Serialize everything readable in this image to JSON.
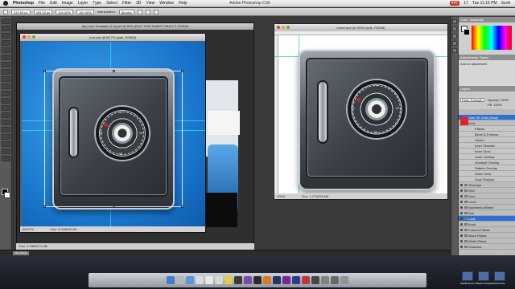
{
  "menubar": {
    "app_name": "Photoshop",
    "menus": [
      "File",
      "Edit",
      "Image",
      "Layer",
      "Type",
      "Select",
      "Filter",
      "3D",
      "View",
      "Window",
      "Help"
    ],
    "window_title": "Adobe Photoshop CS6",
    "status_items": [
      "447",
      "17",
      "Tue 11:15 PM",
      "Scott"
    ]
  },
  "options_bar": {
    "x_value": "513.00 px",
    "y_value": "494.00 px",
    "w_value": "100.00%",
    "h_value": "100.00%",
    "interpolation_label": "Interpolation:",
    "interpolation_value": "Bicubic"
  },
  "doc_back": {
    "title": "App Icon Template (2.3).psd @ 50% (EDIT THIS SMART OBJECT, RGB/8)",
    "status": "Doc: 1.03M/171.3M"
  },
  "doc_front": {
    "title": "icon.psb @ 66.7% (safe, RGB/8)",
    "zoom": "66.67%",
    "status": "Doc: 3.00M/38.1M"
  },
  "doc_right": {
    "title": "locker.psd @ 100% (safe, RGB/8)",
    "zoom": "100%",
    "status": "Doc: 1.27M/19.8M"
  },
  "safe": {
    "dial_numbers": [
      "0",
      "25",
      "50",
      "75"
    ]
  },
  "panels": {
    "color_tabs": [
      "Color",
      "Swatches"
    ],
    "adjust_tabs": [
      "Adjustments",
      "Styles"
    ],
    "adjust_title": "Add an adjustment",
    "layers_tab": "Layers",
    "blend_mode": "Pass Through",
    "opacity_label": "Opacity: 100%",
    "fill_label": "Fill: 100%",
    "layers": [
      {
        "name": "Safe SE Gold (Glow)",
        "type": "active"
      },
      {
        "name": "Door",
        "type": "layer"
      },
      {
        "name": "Effects",
        "type": "effect"
      },
      {
        "name": "Bevel & Emboss",
        "type": "effect"
      },
      {
        "name": "Stroke",
        "type": "effect"
      },
      {
        "name": "Inner Shadow",
        "type": "effect"
      },
      {
        "name": "Inner Glow",
        "type": "effect"
      },
      {
        "name": "Color Overlay",
        "type": "effect"
      },
      {
        "name": "Gradient Overlay",
        "type": "effect"
      },
      {
        "name": "Pattern Overlay",
        "type": "effect"
      },
      {
        "name": "Outer Glow",
        "type": "effect"
      },
      {
        "name": "Drop Shadow",
        "type": "effect"
      },
      {
        "name": "Tiledrops",
        "type": "folder"
      },
      {
        "name": "Grid",
        "type": "folder"
      },
      {
        "name": "Door",
        "type": "folder"
      },
      {
        "name": "Lever",
        "type": "folder"
      },
      {
        "name": "Numbered Wheel",
        "type": "folder"
      },
      {
        "name": "Dial",
        "type": "folder"
      },
      {
        "name": "Lock",
        "type": "folder-active"
      },
      {
        "name": "Knob",
        "type": "folder"
      },
      {
        "name": "Colored Plastic",
        "type": "folder"
      },
      {
        "name": "Black Plastic",
        "type": "folder"
      },
      {
        "name": "White Plastic",
        "type": "folder"
      },
      {
        "name": "Shadows",
        "type": "folder"
      }
    ]
  },
  "minibar": {
    "tab": "Mini Bridge"
  },
  "desktop": {
    "icons": [
      "MacBook Pro",
      "MacPro Desktop",
      "Scott Drive"
    ]
  }
}
